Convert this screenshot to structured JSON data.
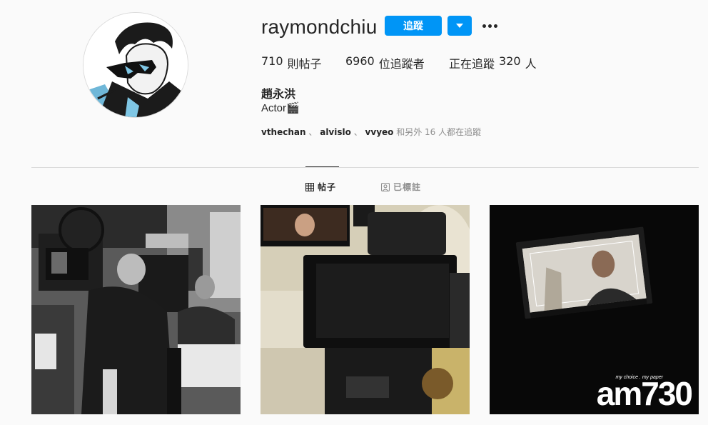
{
  "profile": {
    "username": "raymondchiu",
    "follow_label": "追蹤",
    "full_name": "趙永洪",
    "bio": "Actor🎬"
  },
  "stats": {
    "posts_count": "710",
    "posts_label": "則帖子",
    "followers_count": "6960",
    "followers_label": "位追蹤者",
    "following_prefix": "正在追蹤",
    "following_count": "320",
    "following_suffix": "人"
  },
  "followed_by": {
    "users": [
      "vthechan",
      "alvislo",
      "vvyeo"
    ],
    "separator": "、",
    "suffix": "和另外 16 人都在追蹤"
  },
  "tabs": {
    "posts": "帖子",
    "tagged": "已標註"
  },
  "posts": [
    {
      "watermark_small": "",
      "watermark_big": ""
    },
    {
      "watermark_small": "",
      "watermark_big": ""
    },
    {
      "watermark_small": "my choice . my paper",
      "watermark_big": "am730"
    }
  ],
  "colors": {
    "accent": "#0095f6",
    "text": "#262626",
    "muted": "#8e8e8e",
    "background": "#fafafa",
    "divider": "#dbdbdb"
  },
  "icons": [
    "chevron-down-icon",
    "more-options-icon",
    "grid-icon",
    "tagged-icon"
  ]
}
